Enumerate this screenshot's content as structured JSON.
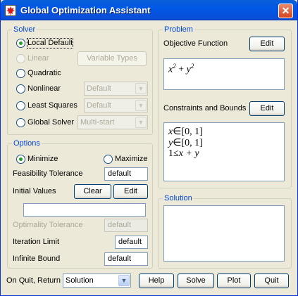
{
  "window": {
    "title": "Global Optimization Assistant",
    "close_glyph": "✕"
  },
  "solver": {
    "legend": "Solver",
    "options": [
      {
        "label": "Local Default",
        "checked": true,
        "enabled": true
      },
      {
        "label": "Linear",
        "checked": false,
        "enabled": false
      },
      {
        "label": "Quadratic",
        "checked": false,
        "enabled": true
      },
      {
        "label": "Nonlinear",
        "checked": false,
        "enabled": true
      },
      {
        "label": "Least Squares",
        "checked": false,
        "enabled": true
      },
      {
        "label": "Global Solver",
        "checked": false,
        "enabled": true
      }
    ],
    "variable_types_label": "Variable Types",
    "nonlinear_method": "Default",
    "least_squares_method": "Default",
    "global_method": "Multi-start"
  },
  "options": {
    "legend": "Options",
    "minimize_label": "Minimize",
    "maximize_label": "Maximize",
    "feasibility_tolerance_label": "Feasibility Tolerance",
    "feasibility_tolerance_value": "default",
    "initial_values_label": "Initial Values",
    "clear_label": "Clear",
    "edit_label": "Edit",
    "initial_values_value": "",
    "optimality_tolerance_label": "Optimality Tolerance",
    "optimality_tolerance_value": "default",
    "iteration_limit_label": "Iteration Limit",
    "iteration_limit_value": "default",
    "infinite_bound_label": "Infinite Bound",
    "infinite_bound_value": "default"
  },
  "problem": {
    "legend": "Problem",
    "objective_label": "Objective Function",
    "objective_edit_label": "Edit",
    "objective": {
      "a": "x",
      "e1": "2",
      "plus": "+",
      "b": "y",
      "e2": "2"
    },
    "constraints_label": "Constraints and Bounds",
    "constraints_edit_label": "Edit",
    "constraints": [
      {
        "var": "x",
        "rel": "∈",
        "range": "[0, 1]"
      },
      {
        "var": "y",
        "rel": "∈",
        "range": "[0, 1]"
      },
      {
        "var": "1",
        "rel": "≤",
        "range": "x + y"
      }
    ]
  },
  "solution": {
    "legend": "Solution"
  },
  "footer": {
    "on_quit_label": "On Quit, Return",
    "on_quit_value": "Solution",
    "help_label": "Help",
    "solve_label": "Solve",
    "plot_label": "Plot",
    "quit_label": "Quit"
  }
}
